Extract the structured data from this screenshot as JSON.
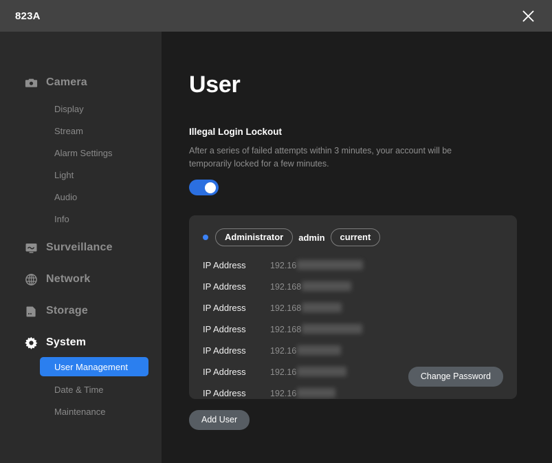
{
  "titlebar": {
    "title": "823A",
    "close_icon": "close-icon"
  },
  "sidebar": {
    "groups": [
      {
        "label": "Camera",
        "icon": "camera-icon",
        "active": false,
        "items": [
          {
            "label": "Display",
            "selected": false
          },
          {
            "label": "Stream",
            "selected": false
          },
          {
            "label": "Alarm Settings",
            "selected": false
          },
          {
            "label": "Light",
            "selected": false
          },
          {
            "label": "Audio",
            "selected": false
          },
          {
            "label": "Info",
            "selected": false
          }
        ]
      },
      {
        "label": "Surveillance",
        "icon": "monitor-icon",
        "active": false,
        "items": []
      },
      {
        "label": "Network",
        "icon": "globe-icon",
        "active": false,
        "items": []
      },
      {
        "label": "Storage",
        "icon": "sdcard-icon",
        "active": false,
        "items": []
      },
      {
        "label": "System",
        "icon": "gear-icon",
        "active": true,
        "items": [
          {
            "label": "User Management",
            "selected": true
          },
          {
            "label": "Date & Time",
            "selected": false
          },
          {
            "label": "Maintenance",
            "selected": false
          }
        ]
      }
    ]
  },
  "main": {
    "page_title": "User",
    "lockout": {
      "title": "Illegal Login Lockout",
      "description": "After a series of failed attempts within 3 minutes, your account will be temporarily locked for a few minutes.",
      "toggle_on": true
    },
    "user_card": {
      "role_pill": "Administrator",
      "username": "admin",
      "status_pill": "current",
      "status_dot_color": "#3b82f6",
      "ip_rows": [
        {
          "label": "IP Address",
          "value": "192.16",
          "redacted_width": 96
        },
        {
          "label": "IP Address",
          "value": "192.168",
          "redacted_width": 72
        },
        {
          "label": "IP Address",
          "value": "192.168",
          "redacted_width": 58
        },
        {
          "label": "IP Address",
          "value": "192.168",
          "redacted_width": 88
        },
        {
          "label": "IP Address",
          "value": "192.16",
          "redacted_width": 64
        },
        {
          "label": "IP Address",
          "value": "192.16",
          "redacted_width": 72
        },
        {
          "label": "IP Address",
          "value": "192.16",
          "redacted_width": 56
        }
      ],
      "change_password_label": "Change Password"
    },
    "add_user_label": "Add User"
  },
  "colors": {
    "accent": "#2b7fef",
    "toggle_on": "#2b6fe0",
    "titlebar_bg": "#434343",
    "sidebar_bg": "#2b2b2b",
    "content_bg": "#1c1c1c",
    "card_bg": "#303030",
    "button_bg": "#575d63"
  }
}
